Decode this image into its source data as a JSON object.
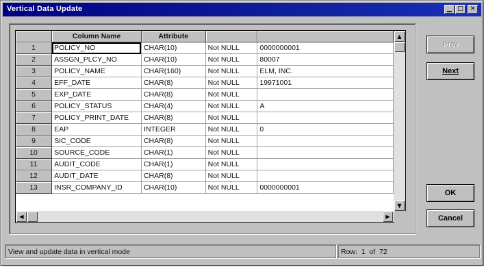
{
  "window": {
    "title": "Vertical Data Update"
  },
  "grid": {
    "headers": [
      "",
      "Column Name",
      "Attribute",
      "",
      ""
    ],
    "rows": [
      {
        "num": "1",
        "name": "POLICY_NO",
        "attr": "CHAR(10)",
        "nul": "Not NULL",
        "value": "0000000001"
      },
      {
        "num": "2",
        "name": "ASSGN_PLCY_NO",
        "attr": "CHAR(10)",
        "nul": "Not NULL",
        "value": "80007"
      },
      {
        "num": "3",
        "name": "POLICY_NAME",
        "attr": "CHAR(160)",
        "nul": "Not NULL",
        "value": "ELM, INC."
      },
      {
        "num": "4",
        "name": "EFF_DATE",
        "attr": "CHAR(8)",
        "nul": "Not NULL",
        "value": "19971001"
      },
      {
        "num": "5",
        "name": "EXP_DATE",
        "attr": "CHAR(8)",
        "nul": "Not NULL",
        "value": ""
      },
      {
        "num": "6",
        "name": "POLICY_STATUS",
        "attr": "CHAR(4)",
        "nul": "Not NULL",
        "value": "A"
      },
      {
        "num": "7",
        "name": "POLICY_PRINT_DATE",
        "attr": "CHAR(8)",
        "nul": "Not NULL",
        "value": ""
      },
      {
        "num": "8",
        "name": "EAP",
        "attr": "INTEGER",
        "nul": "Not NULL",
        "value": "0"
      },
      {
        "num": "9",
        "name": "SIC_CODE",
        "attr": "CHAR(8)",
        "nul": "Not NULL",
        "value": ""
      },
      {
        "num": "10",
        "name": "SOURCE_CODE",
        "attr": "CHAR(1)",
        "nul": "Not NULL",
        "value": ""
      },
      {
        "num": "11",
        "name": "AUDIT_CODE",
        "attr": "CHAR(1)",
        "nul": "Not NULL",
        "value": ""
      },
      {
        "num": "12",
        "name": "AUDIT_DATE",
        "attr": "CHAR(8)",
        "nul": "Not NULL",
        "value": ""
      },
      {
        "num": "13",
        "name": "INSR_COMPANY_ID",
        "attr": "CHAR(10)",
        "nul": "Not NULL",
        "value": "0000000001"
      }
    ]
  },
  "buttons": {
    "prev": "Prev",
    "next": "Next",
    "ok": "OK",
    "cancel": "Cancel"
  },
  "status": {
    "message": "View and update data in vertical mode",
    "row_label": "Row:",
    "row": "1",
    "of_label": "of",
    "total": "72"
  }
}
